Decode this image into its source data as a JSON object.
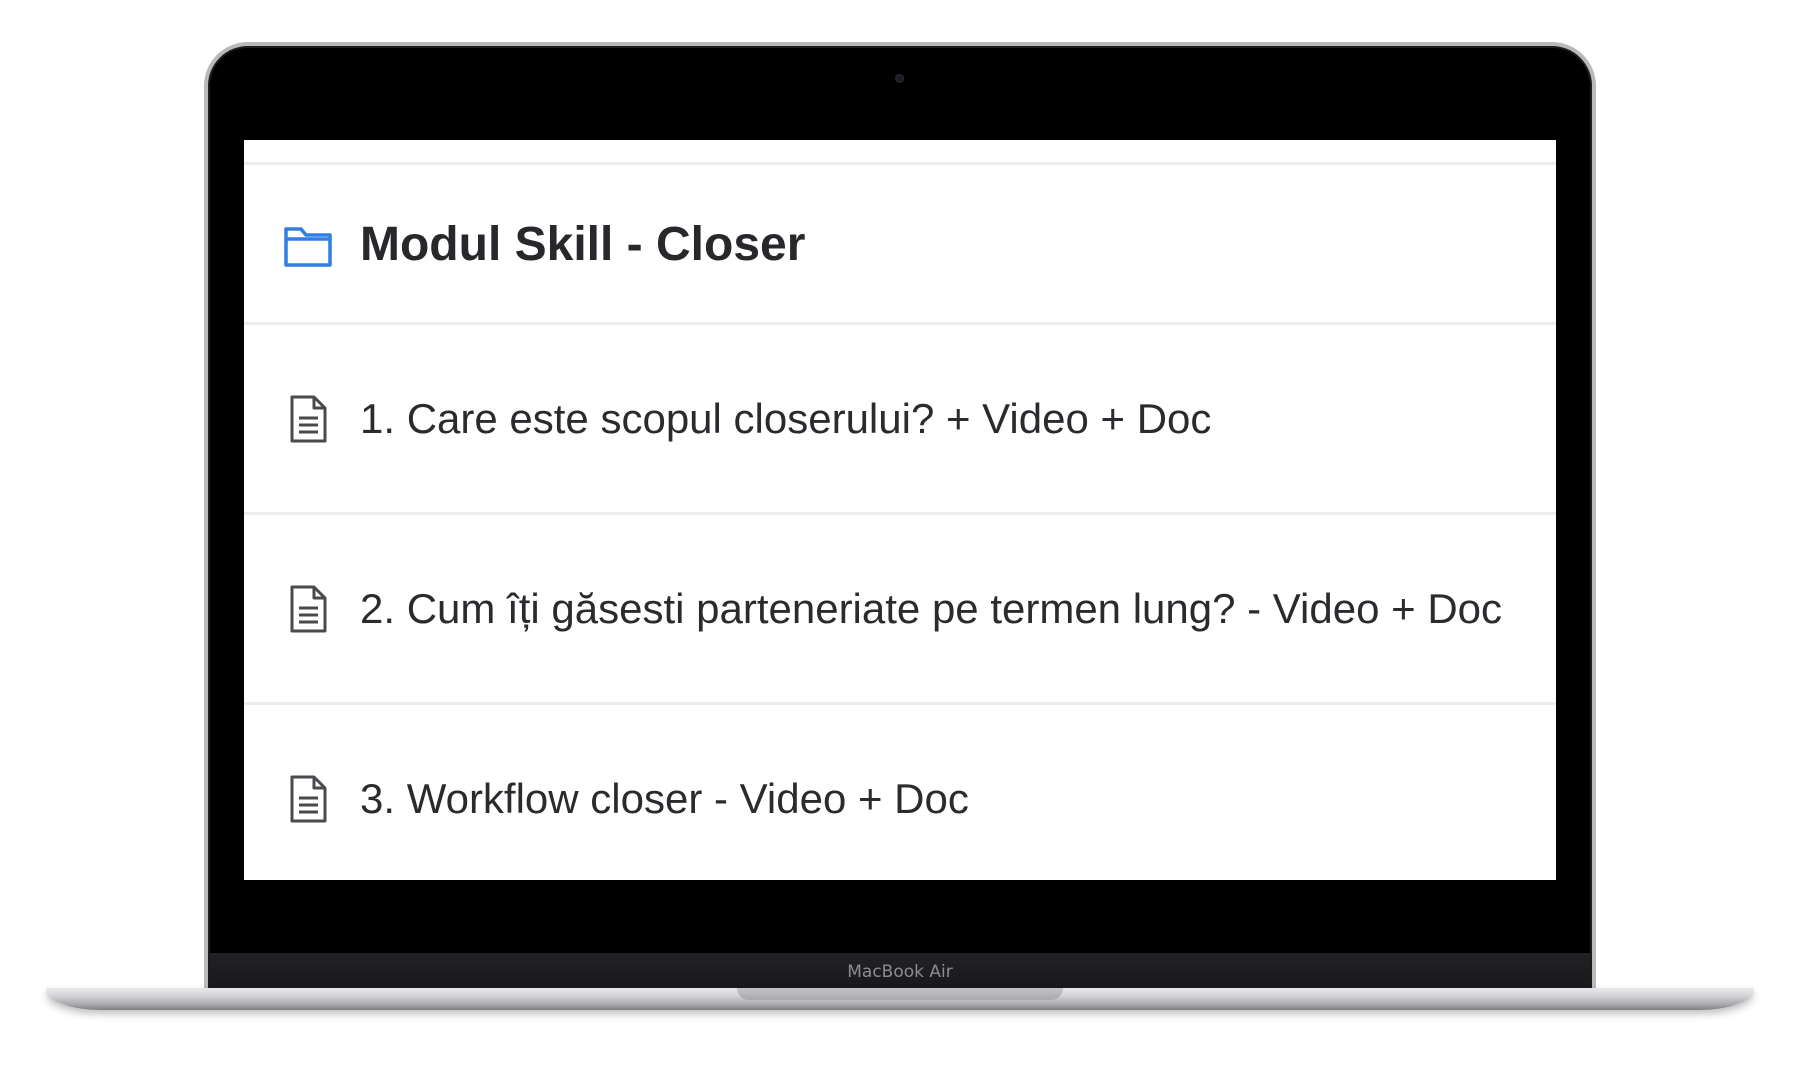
{
  "device": {
    "brand_label": "MacBook Air"
  },
  "module": {
    "title": "Modul Skill - Closer",
    "icon": "folder-icon",
    "accent_color": "#2f7fe4"
  },
  "lessons": [
    {
      "label": "1. Care este scopul closerului? + Video + Doc",
      "icon": "document-icon"
    },
    {
      "label": "2. Cum îți găsesti parteneriate pe termen lung? - Video + Doc",
      "icon": "document-icon"
    },
    {
      "label": "3. Workflow closer - Video + Doc",
      "icon": "document-icon"
    }
  ]
}
